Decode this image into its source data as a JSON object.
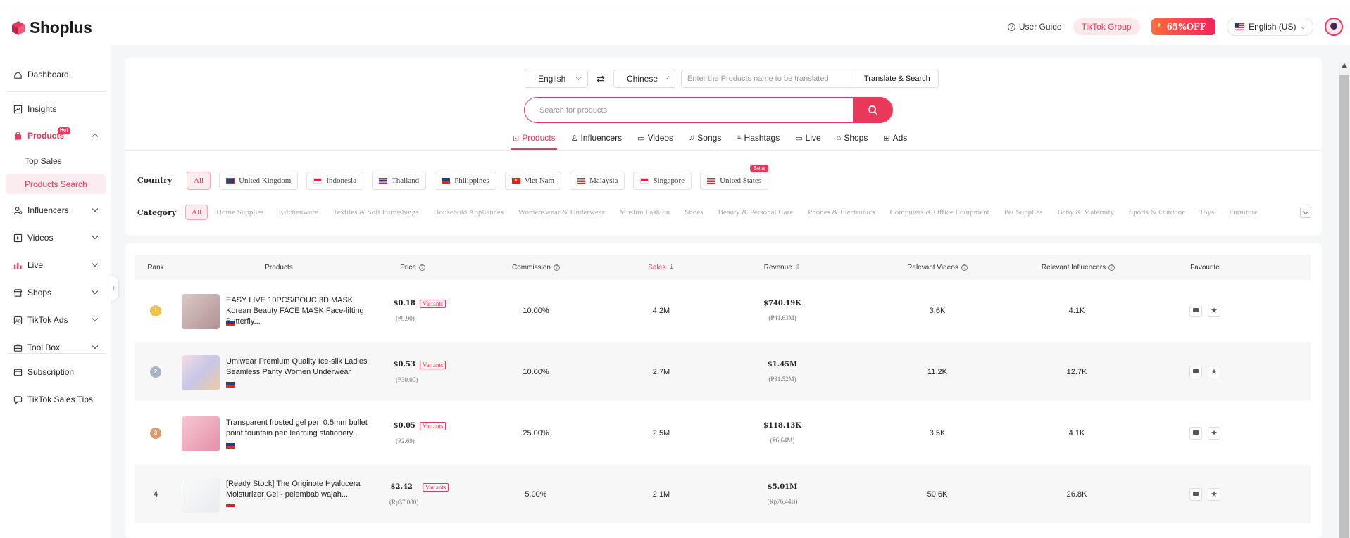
{
  "header": {
    "brand": "Shoplus",
    "user_guide": "User Guide",
    "tiktok_group": "TikTok Group",
    "promo": "65%OFF",
    "language": "English (US)"
  },
  "sidebar": {
    "items": [
      {
        "label": "Dashboard",
        "icon": "home-icon"
      },
      {
        "label": "Insights",
        "icon": "chart-icon"
      },
      {
        "label": "Products",
        "icon": "bag-icon",
        "badge": "Hot"
      },
      {
        "label": "Top Sales"
      },
      {
        "label": "Products Search"
      },
      {
        "label": "Influencers",
        "icon": "user-icon"
      },
      {
        "label": "Videos",
        "icon": "video-icon"
      },
      {
        "label": "Live",
        "icon": "live-icon"
      },
      {
        "label": "Shops",
        "icon": "shop-icon"
      },
      {
        "label": "TikTok Ads",
        "icon": "ads-icon"
      },
      {
        "label": "Tool Box",
        "icon": "toolbox-icon"
      },
      {
        "label": "Subscription",
        "icon": "subscription-icon"
      },
      {
        "label": "TikTok Sales Tips",
        "icon": "chat-icon"
      }
    ]
  },
  "search": {
    "source_lang": "English",
    "target_lang": "Chinese",
    "translate_placeholder": "Enter the Products name to be translated",
    "translate_button": "Translate & Search",
    "placeholder": "Search for products",
    "tabs": [
      "Products",
      "Influencers",
      "Videos",
      "Songs",
      "Hashtags",
      "Live",
      "Shops",
      "Ads"
    ]
  },
  "filters": {
    "country_label": "Country",
    "countries": [
      "All",
      "United Kingdom",
      "Indonesia",
      "Thailand",
      "Philippines",
      "Viet Nam",
      "Malaysia",
      "Singapore",
      "United States"
    ],
    "beta": "Beta",
    "category_label": "Category",
    "categories": [
      "All",
      "Home Supplies",
      "Kitchenware",
      "Textiles & Soft Furnishings",
      "Household Appliances",
      "Womenswear & Underwear",
      "Muslim Fashion",
      "Shoes",
      "Beauty & Personal Care",
      "Phones & Electronics",
      "Computers & Office Equipment",
      "Pet Supplies",
      "Baby & Maternity",
      "Sports & Outdoor",
      "Toys",
      "Furniture"
    ]
  },
  "table": {
    "headers": [
      "Rank",
      "Products",
      "Price",
      "Commission",
      "Sales",
      "Revenue",
      "Relevant Videos",
      "Relevant Influencers",
      "Favourite"
    ],
    "variants_label": "Variants",
    "rows": [
      {
        "rank": "1",
        "name": "EASY LIVE 10PCS/POUC 3D MASK Korean Beauty FACE MASK Face-lifting Butterfly...",
        "price": "$0.18",
        "price_local": "(₱9.90)",
        "commission": "10.00%",
        "sales": "4.2M",
        "revenue": "$740.19K",
        "revenue_local": "(₱41.63M)",
        "videos": "3.6K",
        "influencers": "4.1K"
      },
      {
        "rank": "2",
        "name": "Umiwear Premium Quality Ice-silk Ladies Seamless Panty Women Underwear",
        "price": "$0.53",
        "price_local": "(₱30.00)",
        "commission": "10.00%",
        "sales": "2.7M",
        "revenue": "$1.45M",
        "revenue_local": "(₱81.52M)",
        "videos": "11.2K",
        "influencers": "12.7K"
      },
      {
        "rank": "3",
        "name": "Transparent frosted gel pen 0.5mm bullet point fountain pen learning stationery...",
        "price": "$0.05",
        "price_local": "(₱2.69)",
        "commission": "25.00%",
        "sales": "2.5M",
        "revenue": "$118.13K",
        "revenue_local": "(₱6.64M)",
        "videos": "3.5K",
        "influencers": "4.1K"
      },
      {
        "rank": "4",
        "name": "[Ready Stock] The Originote Hyalucera Moisturizer Gel - pelembab wajah...",
        "price": "$2.42",
        "price_local": "(Rp37.000)",
        "commission": "5.00%",
        "sales": "2.1M",
        "revenue": "$5.01M",
        "revenue_local": "(Rp76,44B)",
        "videos": "50.6K",
        "influencers": "26.8K"
      }
    ]
  },
  "colors": {
    "accent": "#e8395b"
  }
}
